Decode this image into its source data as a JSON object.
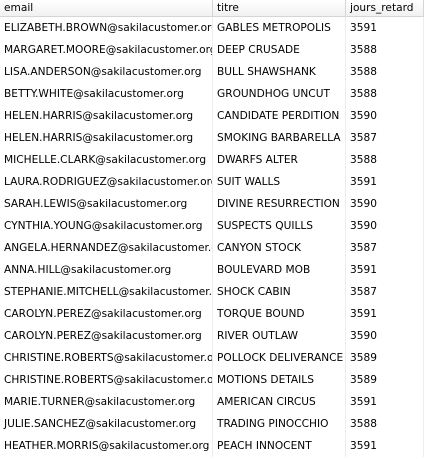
{
  "table": {
    "columns": [
      "email",
      "titre",
      "jours_retard"
    ],
    "rows": [
      {
        "email": "ELIZABETH.BROWN@sakilacustomer.org",
        "titre": "GABLES METROPOLIS",
        "jours_retard": "3591"
      },
      {
        "email": "MARGARET.MOORE@sakilacustomer.org",
        "titre": "DEEP CRUSADE",
        "jours_retard": "3588"
      },
      {
        "email": "LISA.ANDERSON@sakilacustomer.org",
        "titre": "BULL SHAWSHANK",
        "jours_retard": "3588"
      },
      {
        "email": "BETTY.WHITE@sakilacustomer.org",
        "titre": "GROUNDHOG UNCUT",
        "jours_retard": "3588"
      },
      {
        "email": "HELEN.HARRIS@sakilacustomer.org",
        "titre": "CANDIDATE PERDITION",
        "jours_retard": "3590"
      },
      {
        "email": "HELEN.HARRIS@sakilacustomer.org",
        "titre": "SMOKING BARBARELLA",
        "jours_retard": "3587"
      },
      {
        "email": "MICHELLE.CLARK@sakilacustomer.org",
        "titre": "DWARFS ALTER",
        "jours_retard": "3588"
      },
      {
        "email": "LAURA.RODRIGUEZ@sakilacustomer.org",
        "titre": "SUIT WALLS",
        "jours_retard": "3591"
      },
      {
        "email": "SARAH.LEWIS@sakilacustomer.org",
        "titre": "DIVINE RESURRECTION",
        "jours_retard": "3590"
      },
      {
        "email": "CYNTHIA.YOUNG@sakilacustomer.org",
        "titre": "SUSPECTS QUILLS",
        "jours_retard": "3590"
      },
      {
        "email": "ANGELA.HERNANDEZ@sakilacustomer.org",
        "titre": "CANYON STOCK",
        "jours_retard": "3587"
      },
      {
        "email": "ANNA.HILL@sakilacustomer.org",
        "titre": "BOULEVARD MOB",
        "jours_retard": "3591"
      },
      {
        "email": "STEPHANIE.MITCHELL@sakilacustomer....",
        "titre": "SHOCK CABIN",
        "jours_retard": "3587"
      },
      {
        "email": "CAROLYN.PEREZ@sakilacustomer.org",
        "titre": "TORQUE BOUND",
        "jours_retard": "3591"
      },
      {
        "email": "CAROLYN.PEREZ@sakilacustomer.org",
        "titre": "RIVER OUTLAW",
        "jours_retard": "3590"
      },
      {
        "email": "CHRISTINE.ROBERTS@sakilacustomer.org",
        "titre": "POLLOCK DELIVERANCE",
        "jours_retard": "3589"
      },
      {
        "email": "CHRISTINE.ROBERTS@sakilacustomer.org",
        "titre": "MOTIONS DETAILS",
        "jours_retard": "3589"
      },
      {
        "email": "MARIE.TURNER@sakilacustomer.org",
        "titre": "AMERICAN CIRCUS",
        "jours_retard": "3591"
      },
      {
        "email": "JULIE.SANCHEZ@sakilacustomer.org",
        "titre": "TRADING PINOCCHIO",
        "jours_retard": "3588"
      },
      {
        "email": "HEATHER.MORRIS@sakilacustomer.org",
        "titre": "PEACH INNOCENT",
        "jours_retard": "3591"
      }
    ]
  }
}
